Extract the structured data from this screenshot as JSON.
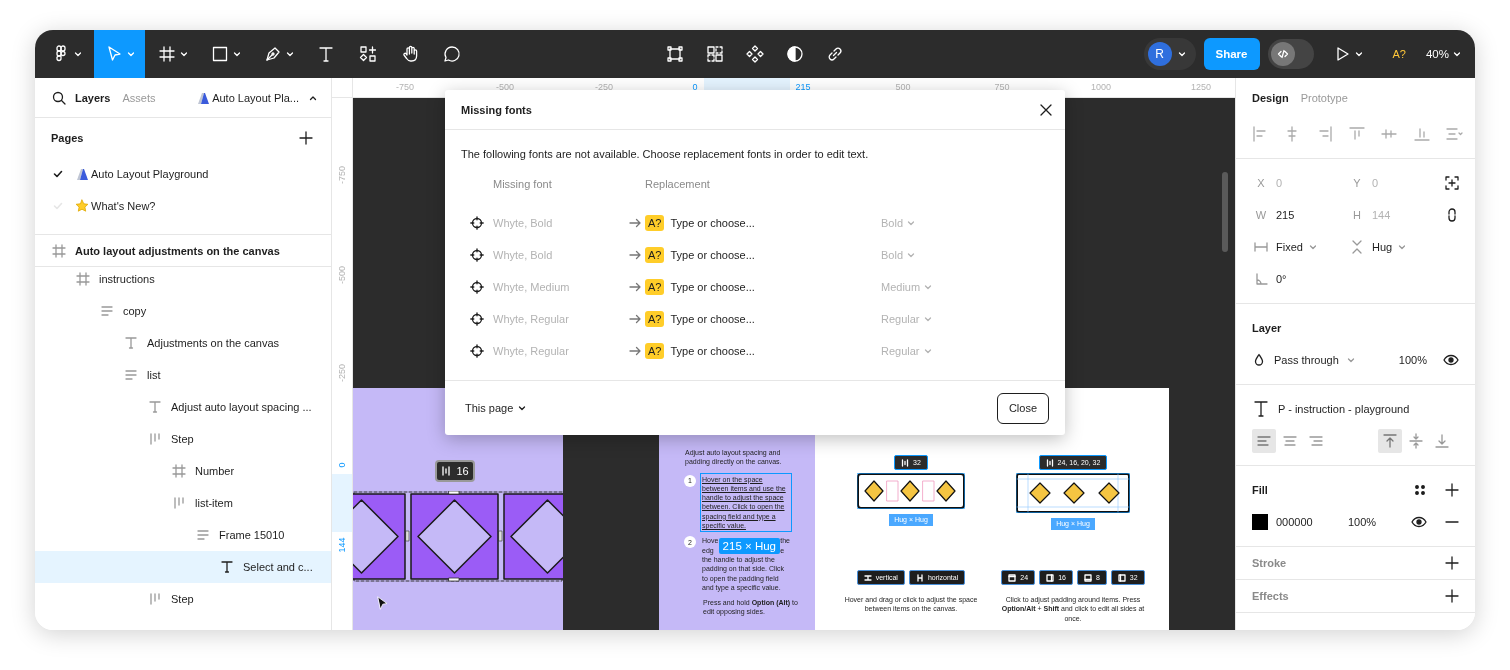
{
  "toolbar": {
    "tools": [
      {
        "kind": "logo",
        "selected": false
      },
      {
        "kind": "move",
        "selected": true
      },
      {
        "kind": "frame",
        "selected": false
      },
      {
        "kind": "shape",
        "selected": false
      },
      {
        "kind": "pen",
        "selected": false
      },
      {
        "kind": "text",
        "selected": false
      },
      {
        "kind": "resources",
        "selected": false
      },
      {
        "kind": "hand",
        "selected": false
      },
      {
        "kind": "comment",
        "selected": false
      }
    ],
    "avatar": "R",
    "share": "Share",
    "dev_mode": false,
    "font_warning": "A?",
    "zoom": "40%"
  },
  "left_panel": {
    "tabs": [
      {
        "label": "Layers",
        "selected": true
      },
      {
        "label": "Assets",
        "selected": false
      }
    ],
    "file_name": "Auto Layout Pla...",
    "pages_title": "Pages",
    "pages": [
      {
        "label": "Auto Layout Playground",
        "kind": "ramp",
        "selected": true
      },
      {
        "label": "What's New?",
        "kind": "star",
        "selected": false
      }
    ],
    "layers": [
      {
        "name": "Auto layout adjustments on the canvas",
        "kind": "frame",
        "selected": false,
        "children": [
          {
            "name": "instructions",
            "kind": "frame",
            "selected": false,
            "children": [
              {
                "name": "copy",
                "kind": "vstack",
                "selected": false,
                "children": [
                  {
                    "name": "Adjustments on the canvas",
                    "kind": "text",
                    "selected": false
                  },
                  {
                    "name": "list",
                    "kind": "vstack",
                    "selected": false,
                    "children": [
                      {
                        "name": "Adjust auto layout spacing ...",
                        "kind": "text",
                        "selected": false
                      },
                      {
                        "name": "Step",
                        "kind": "hstack",
                        "selected": false,
                        "children": [
                          {
                            "name": "Number",
                            "kind": "frame",
                            "selected": false
                          },
                          {
                            "name": "list-item",
                            "kind": "hstack",
                            "selected": false,
                            "children": [
                              {
                                "name": "Frame 15010",
                                "kind": "vstack",
                                "selected": false,
                                "children": [
                                  {
                                    "name": "Select and c...",
                                    "kind": "text",
                                    "selected": true
                                  }
                                ]
                              }
                            ]
                          }
                        ]
                      },
                      {
                        "name": "Step",
                        "kind": "hstack",
                        "selected": false
                      }
                    ]
                  }
                ]
              }
            ]
          }
        ]
      }
    ]
  },
  "rulers": {
    "top": [
      {
        "label": "-750",
        "selected": false
      },
      {
        "label": "-500",
        "selected": false
      },
      {
        "label": "-250",
        "selected": false
      },
      {
        "label": "0",
        "selected": true
      },
      {
        "label": "215",
        "selected": true
      },
      {
        "label": "500",
        "selected": false
      },
      {
        "label": "750",
        "selected": false
      },
      {
        "label": "1000",
        "selected": false
      },
      {
        "label": "1250",
        "selected": false
      }
    ],
    "left": [
      {
        "label": "-750",
        "selected": false
      },
      {
        "label": "-500",
        "selected": false
      },
      {
        "label": "-250",
        "selected": false
      },
      {
        "label": "0",
        "selected": true
      },
      {
        "label": "144",
        "selected": true
      }
    ]
  },
  "canvas": {
    "spacing_badge": "16",
    "instructions": {
      "intro": "Adjust auto layout spacing and padding directly on the canvas.",
      "steps": [
        {
          "number": "1",
          "selected": true,
          "text": "Hover on the space between items and use the handle to adjust the space between. Click to open the spacing field and type a specific value."
        },
        {
          "number": "2",
          "selected": false,
          "visible_fragments": [
            "Hove",
            "the",
            "edg",
            "e"
          ],
          "text": "the handle to adjust the padding on that side. Click to open the padding field and type a specific value."
        }
      ],
      "size_badge": "215 × Hug",
      "note": "Press and hold **Option (Alt)** to edit opposing sides."
    },
    "examples": [
      {
        "kind": "spacing",
        "badge": "32",
        "size": "Hug × Hug",
        "pills": [
          {
            "label": "vertical",
            "kind": "vertical"
          },
          {
            "label": "horizontal",
            "kind": "horizontal"
          }
        ],
        "caption": "Hover and drag or click to adjust the space between items on the canvas."
      },
      {
        "kind": "padding",
        "badge": "24, 16, 20, 32",
        "size": "Hug × Hug",
        "pills": [
          {
            "label": "24",
            "kind": "top"
          },
          {
            "label": "16",
            "kind": "right"
          },
          {
            "label": "8",
            "kind": "bottom"
          },
          {
            "label": "32",
            "kind": "left"
          }
        ],
        "caption": "Click to adjust padding around items. Press **Option/Alt** + **Shift** and click to edit all sides at once."
      }
    ]
  },
  "dialog": {
    "title": "Missing fonts",
    "description": "The following fonts are not available. Choose replacement fonts in order to edit text.",
    "columns": [
      "Missing font",
      "Replacement"
    ],
    "rows": [
      {
        "font": "Whyte, Bold",
        "badge": "A?",
        "placeholder": "Type or choose...",
        "style": "Bold"
      },
      {
        "font": "Whyte, Bold",
        "badge": "A?",
        "placeholder": "Type or choose...",
        "style": "Bold"
      },
      {
        "font": "Whyte, Medium",
        "badge": "A?",
        "placeholder": "Type or choose...",
        "style": "Medium"
      },
      {
        "font": "Whyte, Regular",
        "badge": "A?",
        "placeholder": "Type or choose...",
        "style": "Regular"
      },
      {
        "font": "Whyte, Regular",
        "badge": "A?",
        "placeholder": "Type or choose...",
        "style": "Regular"
      }
    ],
    "scope": "This page",
    "close": "Close"
  },
  "right_panel": {
    "tabs": [
      {
        "label": "Design",
        "selected": true
      },
      {
        "label": "Prototype",
        "selected": false
      }
    ],
    "fields": [
      {
        "label": "X",
        "value": "0",
        "disabled": true
      },
      {
        "label": "Y",
        "value": "0",
        "disabled": true
      },
      {
        "label": "W",
        "value": "215",
        "disabled": false
      },
      {
        "label": "H",
        "value": "144",
        "disabled": true
      }
    ],
    "sizing": [
      {
        "kind": "horizontal",
        "value": "Fixed"
      },
      {
        "kind": "vertical",
        "value": "Hug"
      }
    ],
    "rotation": "0°",
    "layer": {
      "title": "Layer",
      "blend": "Pass through",
      "opacity": "100%"
    },
    "text": {
      "style_name": "P - instruction - playground",
      "h_align": [
        {
          "kind": "left",
          "selected": true
        },
        {
          "kind": "center",
          "selected": false
        },
        {
          "kind": "right",
          "selected": false
        }
      ],
      "v_align": [
        {
          "kind": "top",
          "selected": true
        },
        {
          "kind": "middle",
          "selected": false
        },
        {
          "kind": "bottom",
          "selected": false
        }
      ]
    },
    "fill": {
      "title": "Fill",
      "hex": "000000",
      "opacity": "100%"
    },
    "sections": [
      {
        "title": "Stroke"
      },
      {
        "title": "Effects"
      }
    ]
  }
}
